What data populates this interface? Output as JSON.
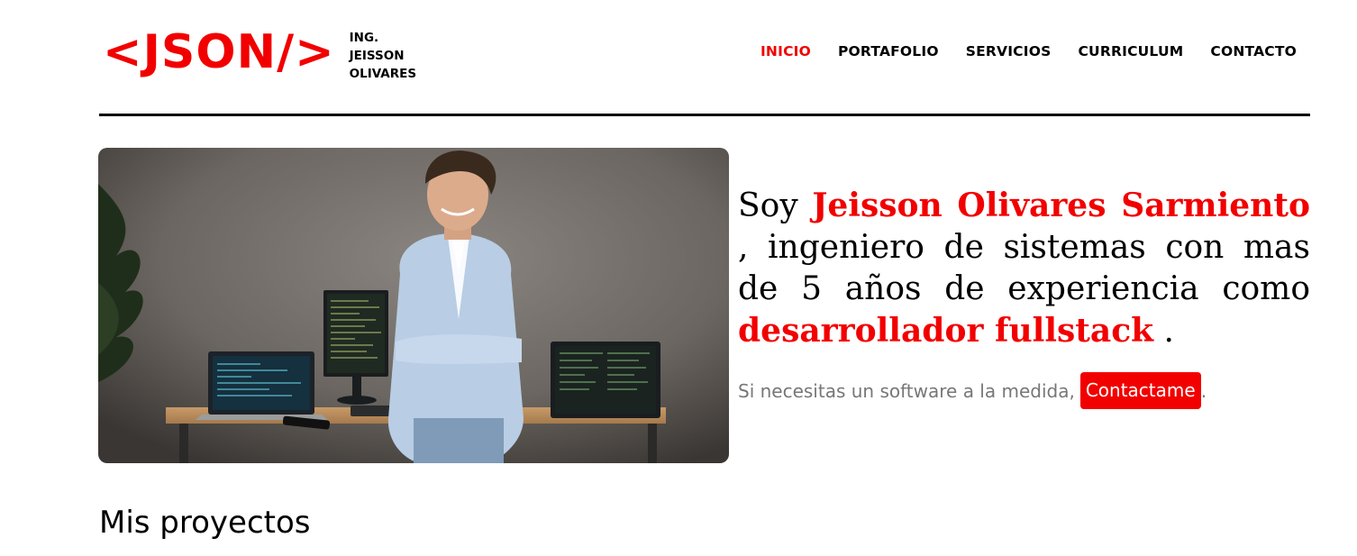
{
  "header": {
    "logo_mark": "<JSON/>",
    "logo_lines": [
      "ING.",
      "JEISSON",
      "OLIVARES"
    ],
    "nav": [
      {
        "label": "INICIO",
        "active": true
      },
      {
        "label": "PORTAFOLIO",
        "active": false
      },
      {
        "label": "SERVICIOS",
        "active": false
      },
      {
        "label": "CURRICULUM",
        "active": false
      },
      {
        "label": "CONTACTO",
        "active": false
      }
    ]
  },
  "hero": {
    "intro": "Soy",
    "name": "Jeisson Olivares Sarmiento",
    "mid": ", ingeniero de sistemas con mas de 5 años de experiencia como",
    "role": "desarrollador fullstack",
    "end": ".",
    "cta_text": "Si necesitas un software a la medida,",
    "cta_button": "Contactame",
    "cta_end": "."
  },
  "projects": {
    "title": "Mis proyectos"
  },
  "colors": {
    "accent": "#f20000",
    "text": "#000000",
    "muted": "#777777"
  }
}
